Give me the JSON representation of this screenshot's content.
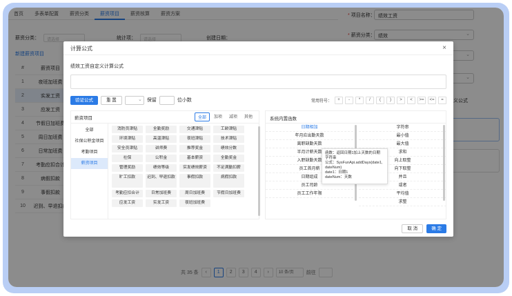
{
  "bg": {
    "tabs": [
      "首页",
      "多表单配置",
      "薪资分类",
      "薪资项目",
      "薪资核算",
      "薪资方案"
    ],
    "active_tab": 3,
    "filters": {
      "category_label": "薪资分类：",
      "category_placeholder": "请选择",
      "method_label": "统计项：",
      "method_placeholder": "请选择",
      "date_label": "创建日期："
    },
    "new_link": "新建薪资项目",
    "table": {
      "header_index": "#",
      "header_name": "薪资项目",
      "rows": [
        {
          "n": "1",
          "name": "夜班加班费"
        },
        {
          "n": "2",
          "name": "实发工资"
        },
        {
          "n": "3",
          "name": "应发工资"
        },
        {
          "n": "4",
          "name": "节假日加班费"
        },
        {
          "n": "5",
          "name": "周日加班费"
        },
        {
          "n": "6",
          "name": "日常加班费"
        },
        {
          "n": "7",
          "name": "考勤应扣合计"
        },
        {
          "n": "8",
          "name": "病假扣款"
        },
        {
          "n": "9",
          "name": "事假扣款"
        },
        {
          "n": "10",
          "name": "迟到、早退扣款"
        }
      ]
    },
    "pager": {
      "total": "共 35 条",
      "pages": [
        "1",
        "2",
        "3",
        "4"
      ],
      "page_size": "10 条/页",
      "goto": "前往",
      "prev": "‹",
      "next": "›"
    }
  },
  "right_panel": {
    "name_label": "项目名称：",
    "name_value": "绩效工资",
    "category_label": "薪资分类：",
    "category_value": "绩效",
    "custom_text": "定义公式"
  },
  "modal": {
    "title": "计算公式",
    "close": "×",
    "subtitle": "绩效工资自定义计算公式",
    "buttons": {
      "verify": "验证公式",
      "reset": "重 置",
      "keep": "保留",
      "decimals": "位小数"
    },
    "symbols_label": "常用符号：",
    "symbols": [
      "+",
      "-",
      "*",
      "/",
      "(",
      ")",
      ">",
      "<",
      ">=",
      "<=",
      "="
    ],
    "salary": {
      "title": "薪资项目",
      "filter_tabs": [
        "全部",
        "加项",
        "减项",
        "其他"
      ],
      "categories": [
        "全部",
        "社保公积金项目",
        "考勤项目",
        "薪资项目"
      ],
      "items": [
        "消防员津贴",
        "全勤奖励",
        "交通津贴",
        "工龄津贴",
        "环境津贴",
        "高温津贴",
        "夜班津贴",
        "技术津贴",
        "安全员津贴",
        "讲师费",
        "推荐奖金",
        "绩效分数",
        "社保",
        "公积金",
        "基本薪资",
        "全勤奖金",
        "管理奖励",
        "绩效等级",
        "实发绩效薪资",
        "不足满勤扣薪",
        "旷工扣款",
        "迟到、早退扣款",
        "事假扣款",
        "病假扣款",
        "考勤应扣合计",
        "日常加班费",
        "周日加班费",
        "节假日加班费",
        "应发工资",
        "实发工资",
        "夜班加班费"
      ]
    },
    "functions": {
      "title": "系统内置函数",
      "left": [
        "日期相加",
        "年月应出勤天数",
        "离职缺勤天数",
        "半月计薪天数",
        "入职缺勤天数",
        "员工首月薪",
        "日期组成",
        "员工司龄",
        "员工工作年限"
      ],
      "right": [
        "字符串",
        "最小值",
        "最大值",
        "求和",
        "向上取整",
        "向下取整",
        "并且",
        "或者",
        "平均值",
        "求整"
      ]
    },
    "tooltip": [
      "函数：返回日期1加上天数的日期",
      "字符串",
      "公式：SysFunApi.addDays(date1,",
      "dateNum)",
      "date1：日期1",
      "dateNum：天数"
    ],
    "footer": {
      "cancel": "取 消",
      "ok": "确 定"
    }
  }
}
